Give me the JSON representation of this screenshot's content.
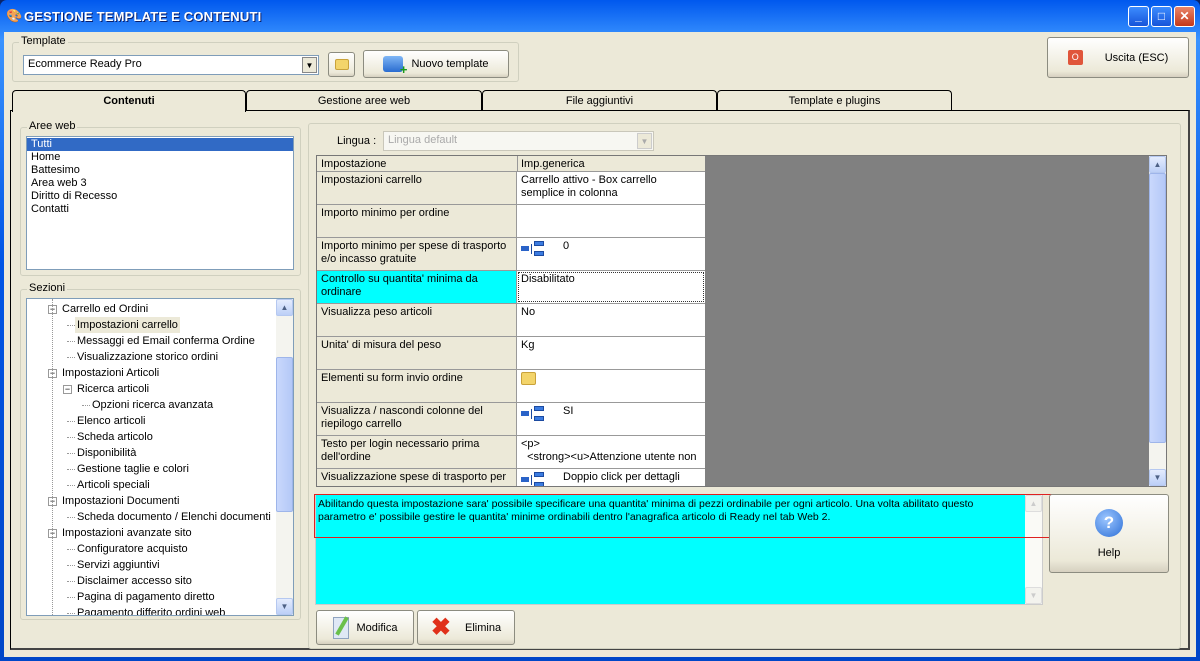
{
  "window": {
    "title": "GESTIONE TEMPLATE E CONTENUTI",
    "minimize": "_",
    "maximize": "□",
    "close": "✕"
  },
  "template": {
    "group_label": "Template",
    "selected": "Ecommerce Ready Pro",
    "new_button": "Nuovo template"
  },
  "exit_button": "Uscita (ESC)",
  "tabs": [
    "Contenuti",
    "Gestione aree web",
    "File aggiuntivi",
    "Template e plugins"
  ],
  "aree_web": {
    "label": "Aree web",
    "items": [
      "Tutti",
      "Home",
      "Battesimo",
      "Area web 3",
      "Diritto di Recesso",
      "Contatti"
    ],
    "selected": "Tutti"
  },
  "sezioni": {
    "label": "Sezioni",
    "items": [
      {
        "text": "Carrello ed Ordini",
        "level": 1,
        "expanded": true
      },
      {
        "text": "Impostazioni carrello",
        "level": 2,
        "selected": true
      },
      {
        "text": "Messaggi ed Email conferma Ordine",
        "level": 2
      },
      {
        "text": "Visualizzazione storico ordini",
        "level": 2
      },
      {
        "text": "Impostazioni Articoli",
        "level": 1,
        "expanded": true
      },
      {
        "text": "Ricerca articoli",
        "level": 2,
        "expanded": true
      },
      {
        "text": "Opzioni ricerca avanzata",
        "level": 3
      },
      {
        "text": "Elenco articoli",
        "level": 2
      },
      {
        "text": "Scheda articolo",
        "level": 2
      },
      {
        "text": "Disponibilità",
        "level": 2
      },
      {
        "text": "Gestione taglie e colori",
        "level": 2
      },
      {
        "text": "Articoli speciali",
        "level": 2
      },
      {
        "text": "Impostazioni Documenti",
        "level": 1,
        "expanded": true
      },
      {
        "text": "Scheda documento / Elenchi documenti",
        "level": 2
      },
      {
        "text": "Impostazioni avanzate sito",
        "level": 1,
        "expanded": true
      },
      {
        "text": "Configuratore acquisto",
        "level": 2
      },
      {
        "text": "Servizi aggiuntivi",
        "level": 2
      },
      {
        "text": "Disclaimer accesso sito",
        "level": 2
      },
      {
        "text": "Pagina di pagamento diretto",
        "level": 2
      },
      {
        "text": "Pagamento differito ordini web",
        "level": 2
      }
    ]
  },
  "lingua": {
    "label": "Lingua :",
    "value": "Lingua default"
  },
  "grid": {
    "headers": [
      "Impostazione",
      "Imp.generica"
    ],
    "rows": [
      {
        "name": "Impostazioni carrello",
        "value": "Carrello attivo - Box carrello semplice in colonna",
        "icon": ""
      },
      {
        "name": "Importo minimo per ordine",
        "value": "",
        "icon": ""
      },
      {
        "name": "Importo minimo per spese di trasporto e/o incasso gratuite",
        "value": "0",
        "icon": "tree-icon"
      },
      {
        "name": "Controllo su quantita' minima da ordinare",
        "value": "Disabilitato",
        "icon": "",
        "selected": true
      },
      {
        "name": "Visualizza peso articoli",
        "value": "No",
        "icon": ""
      },
      {
        "name": "Unita' di misura del peso",
        "value": "Kg",
        "icon": ""
      },
      {
        "name": "Elementi su form invio ordine",
        "value": "",
        "icon": "folder-icon"
      },
      {
        "name": "Visualizza / nascondi colonne del riepilogo carrello",
        "value": "SI",
        "icon": "tree-icon"
      },
      {
        "name": "Testo per login necessario prima dell'ordine",
        "value": "<p>\n  <strong><u>Attenzione utente non",
        "icon": ""
      },
      {
        "name": "Visualizzazione spese di trasporto per",
        "value": "Doppio click per dettagli",
        "icon": "tree-icon"
      }
    ]
  },
  "description": "Abilitando questa impostazione sara' possibile specificare una quantita' minima di pezzi ordinabile per ogni articolo. Una volta abilitato questo parametro e' possibile gestire le quantita' minime ordinabili dentro l'anagrafica articolo di Ready nel tab Web 2.",
  "buttons": {
    "help": "Help",
    "modifica": "Modifica",
    "elimina": "Elimina"
  },
  "colors": {
    "highlight": "#00ffff",
    "selection": "#316ac5",
    "title_bar": "#0055e5"
  }
}
